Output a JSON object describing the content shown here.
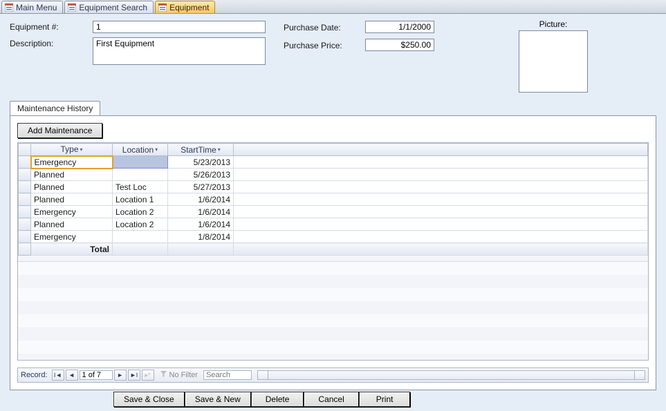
{
  "tabs": [
    {
      "label": "Main Menu",
      "active": false
    },
    {
      "label": "Equipment Search",
      "active": false
    },
    {
      "label": "Equipment",
      "active": true
    }
  ],
  "form": {
    "equipment_num_label": "Equipment #:",
    "equipment_num": "1",
    "description_label": "Description:",
    "description": "First Equipment",
    "purchase_date_label": "Purchase Date:",
    "purchase_date": "1/1/2000",
    "purchase_price_label": "Purchase Price:",
    "purchase_price": "$250.00",
    "picture_label": "Picture:"
  },
  "subtab": {
    "label": "Maintenance History"
  },
  "add_button": "Add Maintenance",
  "grid": {
    "columns": [
      "Type",
      "Location",
      "StartTime"
    ],
    "rows": [
      {
        "type": "Emergency",
        "location": "",
        "start": "5/23/2013",
        "active": true
      },
      {
        "type": "Planned",
        "location": "",
        "start": "5/26/2013"
      },
      {
        "type": "Planned",
        "location": "Test Loc",
        "start": "5/27/2013"
      },
      {
        "type": "Planned",
        "location": "Location 1",
        "start": "1/6/2014"
      },
      {
        "type": "Emergency",
        "location": "Location 2",
        "start": "1/6/2014"
      },
      {
        "type": "Planned",
        "location": "Location 2",
        "start": "1/6/2014"
      },
      {
        "type": "Emergency",
        "location": "",
        "start": "1/8/2014"
      }
    ],
    "total_label": "Total"
  },
  "recnav": {
    "label": "Record:",
    "position": "1 of 7",
    "nofilter": "No Filter",
    "search_placeholder": "Search"
  },
  "footer": {
    "save_close": "Save & Close",
    "save_new": "Save & New",
    "delete": "Delete",
    "cancel": "Cancel",
    "print": "Print"
  }
}
